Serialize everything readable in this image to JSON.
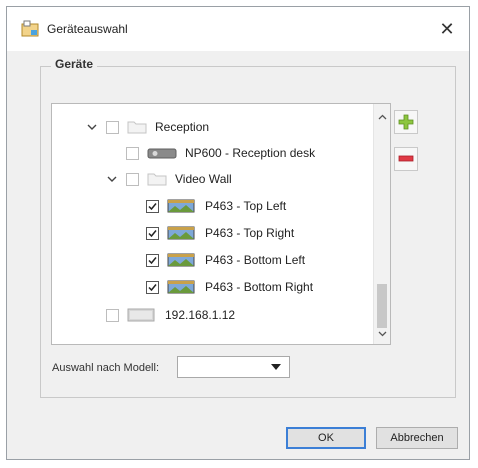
{
  "window": {
    "title": "Geräteauswahl"
  },
  "group": {
    "title": "Geräte"
  },
  "tree": {
    "items": [
      {
        "label": "Reception",
        "checked": false,
        "kind": "folder",
        "expanded": true
      },
      {
        "label": "NP600 - Reception desk",
        "checked": false,
        "kind": "device-grey"
      },
      {
        "label": "Video Wall",
        "checked": false,
        "kind": "folder",
        "expanded": true
      },
      {
        "label": "P463 - Top Left",
        "checked": true,
        "kind": "display"
      },
      {
        "label": "P463 - Top Right",
        "checked": true,
        "kind": "display"
      },
      {
        "label": "P463 - Bottom Left",
        "checked": true,
        "kind": "display"
      },
      {
        "label": "P463 - Bottom Right",
        "checked": true,
        "kind": "display"
      },
      {
        "label": "192.168.1.12",
        "checked": false,
        "kind": "device-grey"
      }
    ]
  },
  "model_filter": {
    "label": "Auswahl nach Modell:",
    "value": ""
  },
  "buttons": {
    "ok": "OK",
    "cancel": "Abbrechen"
  },
  "colors": {
    "accent": "#3c7fd6",
    "add": "#8dc63f",
    "remove": "#e03a45"
  }
}
